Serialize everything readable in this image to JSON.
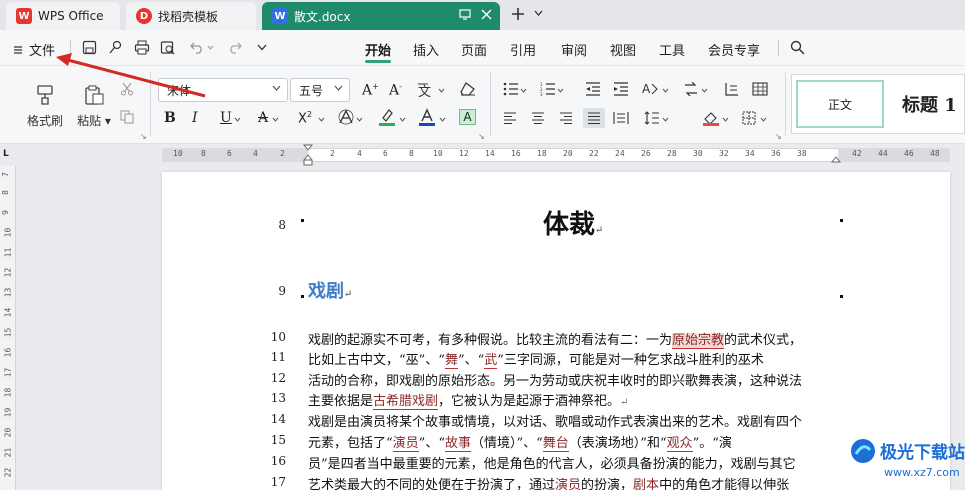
{
  "tabs": {
    "wps": "WPS Office",
    "template": "找稻壳模板",
    "doc": "散文.docx"
  },
  "menu": {
    "file": "文件",
    "tabs": [
      "开始",
      "插入",
      "页面",
      "引用",
      "审阅",
      "视图",
      "工具",
      "会员专享"
    ]
  },
  "ribbon": {
    "format_painter": "格式刷",
    "paste": "粘贴",
    "font_name": "宋体",
    "font_size": "五号",
    "style_normal": "正文",
    "style_heading": "标题 1"
  },
  "ruler": {
    "h_numbers": [
      "10",
      "8",
      "6",
      "4",
      "2",
      "2",
      "4",
      "6",
      "8",
      "10",
      "12",
      "14",
      "16",
      "18",
      "20",
      "22",
      "24",
      "26",
      "28",
      "30",
      "32",
      "34",
      "36",
      "38",
      "42",
      "44",
      "46",
      "48"
    ],
    "v_numbers": [
      "7",
      "8",
      "9",
      "10",
      "11",
      "12",
      "13",
      "14",
      "15",
      "16",
      "17",
      "18",
      "19",
      "20",
      "21",
      "22"
    ]
  },
  "document": {
    "line_numbers": [
      "8",
      "9",
      "10",
      "11",
      "12",
      "13",
      "14",
      "15",
      "16",
      "17"
    ],
    "title": "体裁",
    "heading": "戏剧",
    "lines": {
      "l10a": "戏剧的起源实不可考，有多种假说。比较主流的看法有二：一为",
      "l10b": "原始宗教",
      "l10c": "的武术仪式，",
      "l11a": "比如上古中文，“巫”、“",
      "l11b": "舞",
      "l11c": "”、“",
      "l11d": "武",
      "l11e": "”三字同源，可能是对一种乞求战斗胜利的巫术",
      "l12": "活动的合称，即戏剧的原始形态。另一为劳动或庆祝丰收时的即兴歌舞表演，这种说法",
      "l13a": "主要依据是",
      "l13b": "古希腊戏剧",
      "l13c": "，它被认为是起源于酒神祭祀。",
      "l14": "戏剧是由演员将某个故事或情境，以对话、歌唱或动作式表演出来的艺术。戏剧有四个",
      "l15a": "元素，包括了“",
      "l15b": "演员",
      "l15c": "”、“",
      "l15d": "故事",
      "l15e": "（情境）”、“",
      "l15f": "舞台",
      "l15g": "（表演场地）”和“",
      "l15h": "观众",
      "l15i": "”。“演",
      "l16": "员”是四者当中最重要的元素，他是角色的代言人，必须具备扮演的能力，戏剧与其它",
      "l17a": "艺术类最大的不同的处便在于扮演了，通过",
      "l17b": "演员",
      "l17c": "的扮演，",
      "l17d": "剧本",
      "l17e": "中的角色才能得以伸张"
    }
  },
  "watermark": {
    "brand": "极光下载站",
    "url": "www.xz7.com"
  },
  "colors": {
    "accent": "#2ea37c",
    "doc_tab": "#1f8b6d",
    "heading_blue": "#3d7ec5",
    "arrow_red": "#d42a24"
  }
}
